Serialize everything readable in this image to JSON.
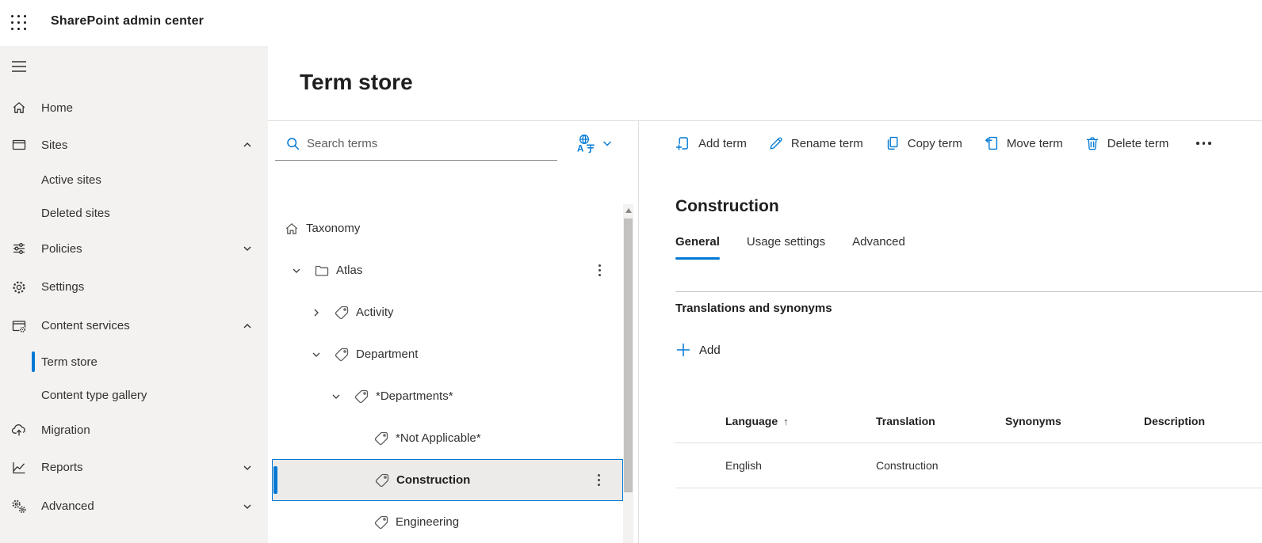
{
  "app": {
    "title": "SharePoint admin center"
  },
  "colors": {
    "accent": "#0078d4",
    "sidebar_bg": "#f3f2f1",
    "selected_fill": "#edebe9",
    "divider": "#e1dfdd"
  },
  "sidebar": {
    "items": [
      {
        "label": "Home"
      },
      {
        "label": "Sites",
        "expanded": true
      },
      {
        "label": "Active sites"
      },
      {
        "label": "Deleted sites"
      },
      {
        "label": "Policies",
        "expanded": false
      },
      {
        "label": "Settings"
      },
      {
        "label": "Content services",
        "expanded": true
      },
      {
        "label": "Term store",
        "selected": true
      },
      {
        "label": "Content type gallery"
      },
      {
        "label": "Migration"
      },
      {
        "label": "Reports",
        "expanded": false
      },
      {
        "label": "Advanced",
        "expanded": false
      }
    ]
  },
  "term_store": {
    "title": "Term store",
    "search_placeholder": "Search terms",
    "tree": {
      "items": [
        {
          "label": "Taxonomy",
          "level": 0
        },
        {
          "label": "Atlas",
          "level": 1,
          "expanded": true
        },
        {
          "label": "Activity",
          "level": 2,
          "expanded": false
        },
        {
          "label": "Department",
          "level": 2,
          "expanded": true
        },
        {
          "label": "*Departments*",
          "level": 3,
          "expanded": true
        },
        {
          "label": "*Not Applicable*",
          "level": 4
        },
        {
          "label": "Construction",
          "level": 4,
          "selected": true
        },
        {
          "label": "Engineering",
          "level": 4
        }
      ]
    }
  },
  "detail": {
    "toolbar": {
      "add": "Add term",
      "rename": "Rename term",
      "copy": "Copy term",
      "move": "Move term",
      "delete": "Delete term"
    },
    "title": "Construction",
    "tabs": [
      {
        "label": "General",
        "active": true
      },
      {
        "label": "Usage settings"
      },
      {
        "label": "Advanced"
      }
    ],
    "section_title": "Translations and synonyms",
    "add_button": "Add",
    "table": {
      "headers": [
        "Language",
        "Translation",
        "Synonyms",
        "Description"
      ],
      "sort_arrow": "↑",
      "rows": [
        {
          "language": "English",
          "translation": "Construction",
          "synonyms": "",
          "description": ""
        }
      ]
    }
  }
}
